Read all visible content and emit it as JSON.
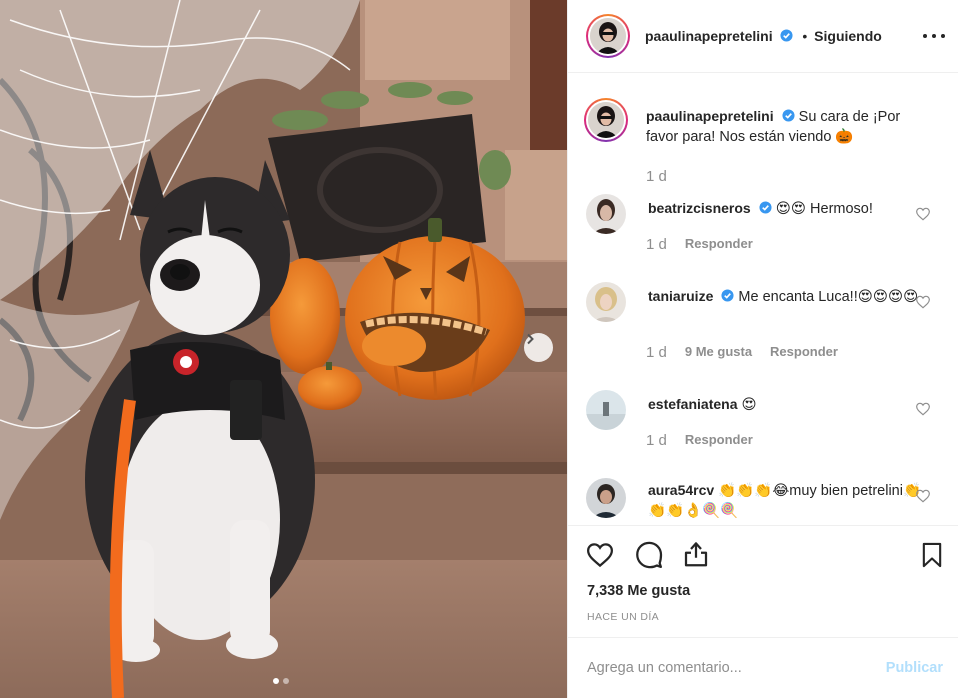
{
  "post": {
    "author": "paaulinapepretelini",
    "follow_label": "Siguiendo",
    "dot": "•",
    "caption": "Su cara de ¡Por favor para! Nos están viendo 🎃",
    "caption_age": "1 d"
  },
  "comments": [
    {
      "user": "beatrizcisneros",
      "verified": true,
      "text": "😍😍 Hermoso!",
      "age": "1 d",
      "likes": "",
      "reply": "Responder"
    },
    {
      "user": "taniaruize",
      "verified": true,
      "text": "Me encanta Luca!!😍😍😍😍",
      "age": "1 d",
      "likes": "9 Me gusta",
      "reply": "Responder"
    },
    {
      "user": "estefaniatena",
      "verified": false,
      "text": "😍",
      "age": "1 d",
      "likes": "",
      "reply": "Responder"
    },
    {
      "user": "aura54rcv",
      "verified": false,
      "text": "👏👏👏😂muy bien petrelini👏👏👏👌🍭🍭",
      "age": "",
      "likes": "",
      "reply": ""
    }
  ],
  "stats": {
    "likes": "7,338 Me gusta",
    "time": "HACE UN DÍA"
  },
  "composer": {
    "placeholder": "Agrega un comentario...",
    "submit": "Publicar"
  },
  "icons": {
    "verified": "verified-badge-icon",
    "more": "more-options-icon",
    "like": "heart-icon",
    "comment": "comment-bubble-icon",
    "share": "share-icon",
    "save": "bookmark-icon",
    "next": "chevron-right-icon"
  },
  "colors": {
    "verified": "#3897f0",
    "publish_disabled": "#b2dffc",
    "muted": "#8e8e8e",
    "text": "#262626"
  },
  "carousel": {
    "count": 2,
    "active": 1
  }
}
